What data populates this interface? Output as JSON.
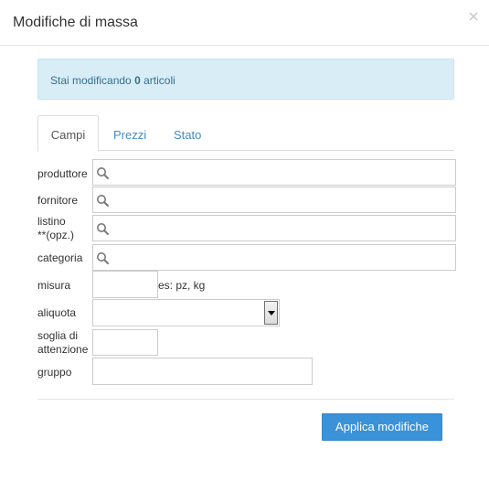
{
  "modal": {
    "title": "Modifiche di massa"
  },
  "alert": {
    "prefix": "Stai modificando",
    "count": "0",
    "suffix": "articoli"
  },
  "tabs": [
    {
      "label": "Campi",
      "active": true
    },
    {
      "label": "Prezzi",
      "active": false
    },
    {
      "label": "Stato",
      "active": false
    }
  ],
  "form": {
    "produttore": {
      "label": "produttore",
      "value": ""
    },
    "fornitore": {
      "label": "fornitore",
      "value": ""
    },
    "listino": {
      "label_line1": "listino",
      "label_line2": "**(opz.)",
      "value": ""
    },
    "categoria": {
      "label": "categoria",
      "value": ""
    },
    "misura": {
      "label": "misura",
      "value": "",
      "hint": "es: pz, kg"
    },
    "aliquota": {
      "label": "aliquota",
      "value": ""
    },
    "soglia": {
      "label_line1": "soglia di",
      "label_line2": "attenzione",
      "value": ""
    },
    "gruppo": {
      "label": "gruppo",
      "value": ""
    }
  },
  "footer": {
    "apply_label": "Applica modifiche"
  },
  "colors": {
    "accent": "#3a92d8",
    "link": "#428bca",
    "alert_bg": "#d9edf7",
    "alert_text": "#31708f"
  },
  "icons": {
    "search": "magnifier-icon",
    "close": "close-icon",
    "dropdown": "triangle-down-icon"
  }
}
